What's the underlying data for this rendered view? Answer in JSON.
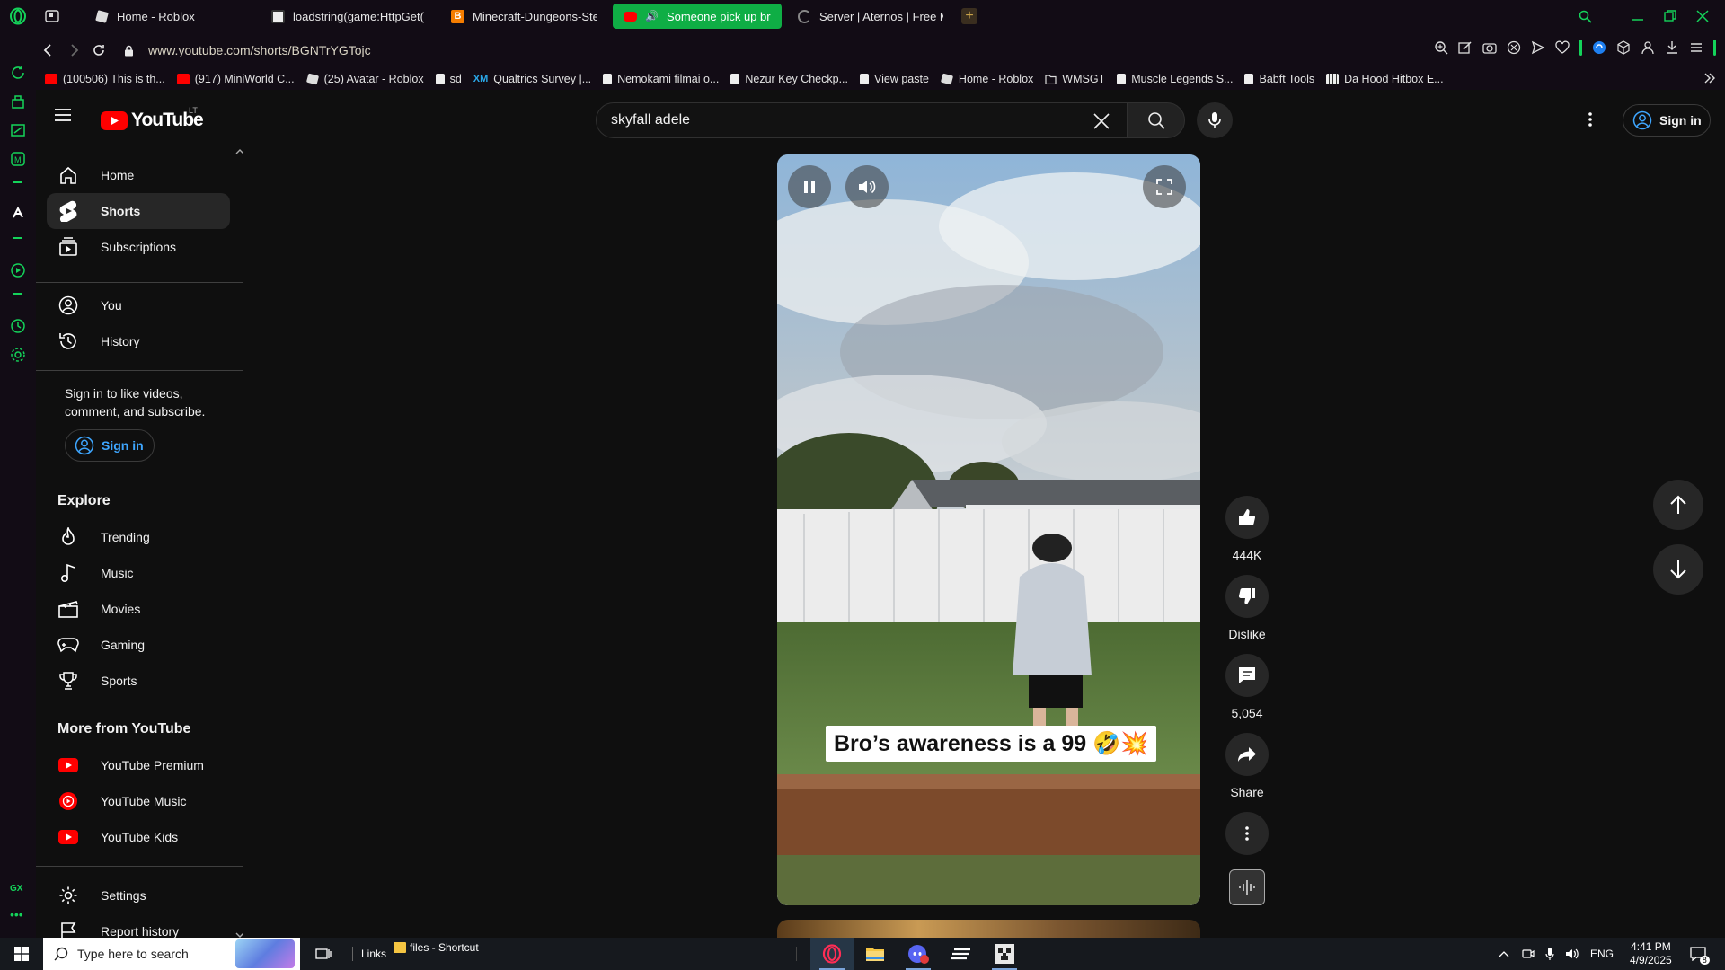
{
  "browser": {
    "tabs": [
      {
        "label": "Home - Roblox",
        "icon": "roblox-icon",
        "active": false
      },
      {
        "label": "loadstring(game:HttpGet(",
        "icon": "pastebin-icon",
        "active": false
      },
      {
        "label": "Minecraft-Dungeons-Ste",
        "icon": "blogger-icon",
        "active": false
      },
      {
        "label": "Someone pick up bro'",
        "icon": "youtube-icon",
        "active": true
      },
      {
        "label": "Server | Aternos | Free M",
        "icon": "loading-spinner-icon",
        "active": false
      }
    ],
    "new_tab_label": "+",
    "url": "www.youtube.com/shorts/BGNTrYGTojc",
    "bookmarks": [
      {
        "label": "(100506) This is th...",
        "icon": "youtube-icon"
      },
      {
        "label": "(917) MiniWorld C...",
        "icon": "youtube-icon"
      },
      {
        "label": "(25) Avatar - Roblox",
        "icon": "roblox-icon"
      },
      {
        "label": "sd",
        "icon": "page-icon"
      },
      {
        "label": "Qualtrics Survey |...",
        "icon": "qualtrics-icon"
      },
      {
        "label": "Nemokami filmai o...",
        "icon": "page-icon"
      },
      {
        "label": "Nezur Key Checkp...",
        "icon": "page-icon"
      },
      {
        "label": "View paste",
        "icon": "page-icon"
      },
      {
        "label": "Home - Roblox",
        "icon": "roblox-icon"
      },
      {
        "label": "WMSGT",
        "icon": "folder-icon"
      },
      {
        "label": "Muscle Legends S...",
        "icon": "page-icon"
      },
      {
        "label": "Babft Tools",
        "icon": "page-icon"
      },
      {
        "label": "Da Hood Hitbox E...",
        "icon": "grid-icon"
      }
    ]
  },
  "youtube": {
    "logo_text": "YouTube",
    "country_code": "LT",
    "search_query": "skyfall adele",
    "sign_in_label": "Sign in",
    "guide": {
      "main": [
        "Home",
        "Shorts",
        "Subscriptions"
      ],
      "you": [
        "You",
        "History"
      ],
      "signin_prompt": "Sign in to like videos, comment, and subscribe.",
      "signin_button": "Sign in",
      "explore_title": "Explore",
      "explore": [
        "Trending",
        "Music",
        "Movies",
        "Gaming",
        "Sports"
      ],
      "more_title": "More from YouTube",
      "more": [
        "YouTube Premium",
        "YouTube Music",
        "YouTube Kids"
      ],
      "settings": [
        "Settings",
        "Report history"
      ]
    },
    "short": {
      "caption": "Bro’s awareness is a 99 🤣💥",
      "likes": "444K",
      "dislike_label": "Dislike",
      "comments": "5,054",
      "share_label": "Share"
    }
  },
  "taskbar": {
    "search_placeholder": "Type here to search",
    "links_label": "Links",
    "files_label": "files - Shortcut",
    "language": "ENG",
    "time": "4:41 PM",
    "date": "4/9/2025",
    "notification_count": "8"
  },
  "colors": {
    "opera_accent": "#0fae45",
    "youtube_red": "#ff0000",
    "link_blue": "#3ea6ff"
  }
}
